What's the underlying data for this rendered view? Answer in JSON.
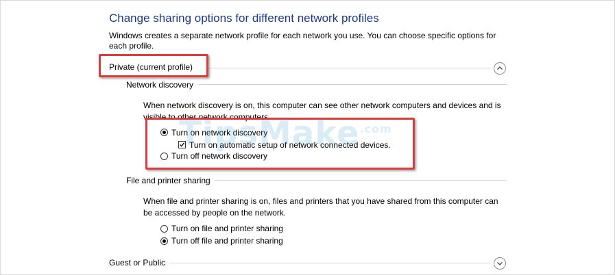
{
  "header": {
    "title": "Change sharing options for different network profiles",
    "description": "Windows creates a separate network profile for each network you use. You can choose specific options for each profile."
  },
  "private": {
    "label": "Private (current profile)",
    "network_discovery": {
      "label": "Network discovery",
      "description": "When network discovery is on, this computer can see other network computers and devices and is visible to other network computers.",
      "options": [
        {
          "label": "Turn on network discovery",
          "selected": true
        },
        {
          "label": "Turn off network discovery",
          "selected": false
        }
      ],
      "auto_setup": {
        "label": "Turn on automatic setup of network connected devices.",
        "checked": true
      }
    },
    "file_printer_sharing": {
      "label": "File and printer sharing",
      "description": "When file and printer sharing is on, files and printers that you have shared from this computer can be accessed by people on the network.",
      "options": [
        {
          "label": "Turn on file and printer sharing",
          "selected": false
        },
        {
          "label": "Turn off file and printer sharing",
          "selected": true
        }
      ]
    }
  },
  "guest_public": {
    "label": "Guest or Public"
  },
  "icons": {
    "collapse": "chevron-up-icon",
    "expand": "chevron-down-icon"
  },
  "highlight_color": "#e03a3a",
  "watermark": {
    "text": "TipsMake",
    "suffix": ".com"
  }
}
